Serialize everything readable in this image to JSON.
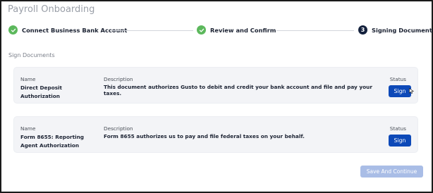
{
  "page": {
    "title": "Payroll Onboarding"
  },
  "stepper": {
    "steps": [
      {
        "label": "Connect Business Bank Account",
        "state": "complete",
        "icon": "check-icon"
      },
      {
        "label": "Review and Confirm",
        "state": "complete",
        "icon": "check-icon"
      },
      {
        "label": "Signing Documents",
        "state": "current",
        "number": "3"
      }
    ]
  },
  "section": {
    "label": "Sign Documents"
  },
  "documents": [
    {
      "name_label": "Name",
      "name": "Direct Deposit Authorization",
      "description_label": "Description",
      "description": "This document authorizes Gusto to debit and credit your bank account and file and pay your taxes.",
      "status_label": "Status",
      "button_label": "Sign"
    },
    {
      "name_label": "Name",
      "name": "Form 8655: Reporting Agent Authorization",
      "description_label": "Description",
      "description": "Form 8655 authorizes us to pay and file federal taxes on your behalf.",
      "status_label": "Status",
      "button_label": "Sign"
    }
  ],
  "footer": {
    "save_label": "Save And Continue"
  },
  "colors": {
    "complete": "#5cb85c",
    "current": "#14213d",
    "primary_button": "#0d49b8",
    "disabled_button": "#a9bde6",
    "card_background": "#f3f4f7"
  }
}
